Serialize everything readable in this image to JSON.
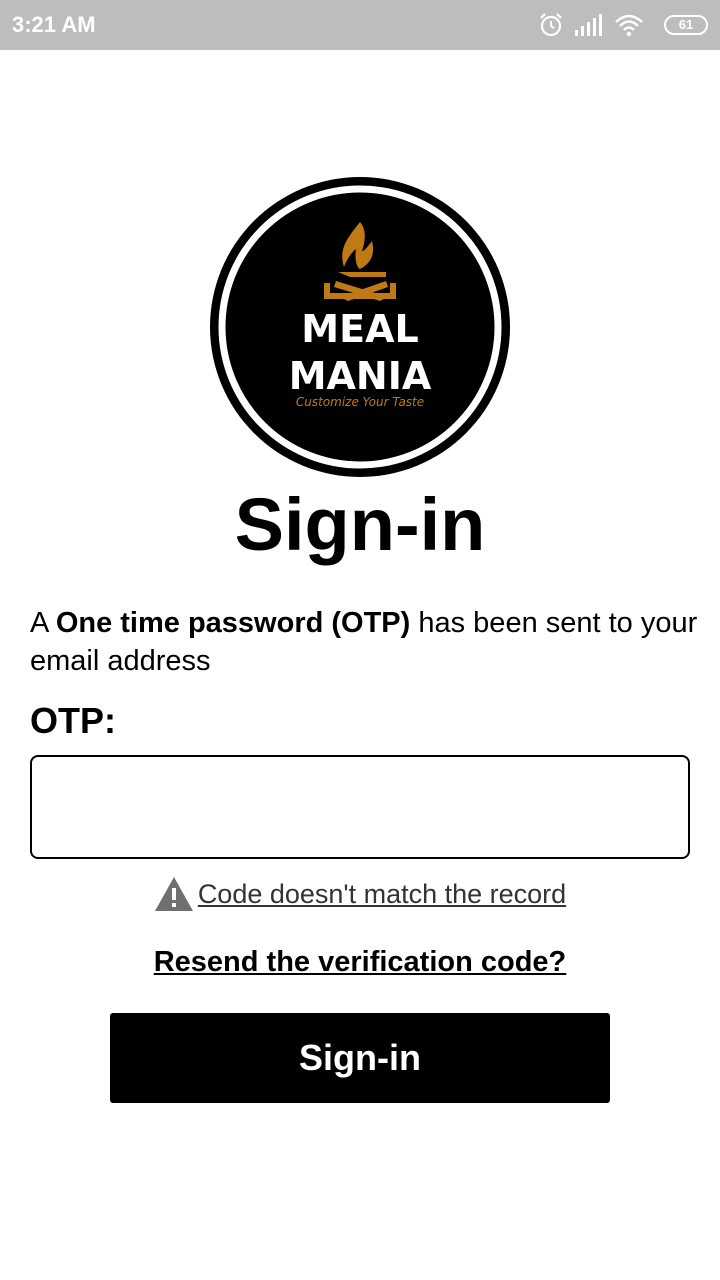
{
  "status_bar": {
    "time": "3:21 AM",
    "battery": "61",
    "icons": [
      "alarm-icon",
      "signal-icon",
      "wifi-icon",
      "battery-icon"
    ]
  },
  "logo": {
    "line1": "MEAL",
    "line2": "MANIA",
    "tagline": "Customize Your Taste",
    "accent_color": "#c07a14"
  },
  "title": "Sign-in",
  "message": {
    "prefix": "A ",
    "bold": "One time password (OTP)",
    "suffix": " has been sent to your email address"
  },
  "otp": {
    "label": "OTP:",
    "value": "",
    "placeholder": ""
  },
  "error": {
    "icon": "warning-icon",
    "text": "Code doesn't match the record"
  },
  "resend_label": "Resend the verification code?",
  "signin_button": "Sign-in"
}
